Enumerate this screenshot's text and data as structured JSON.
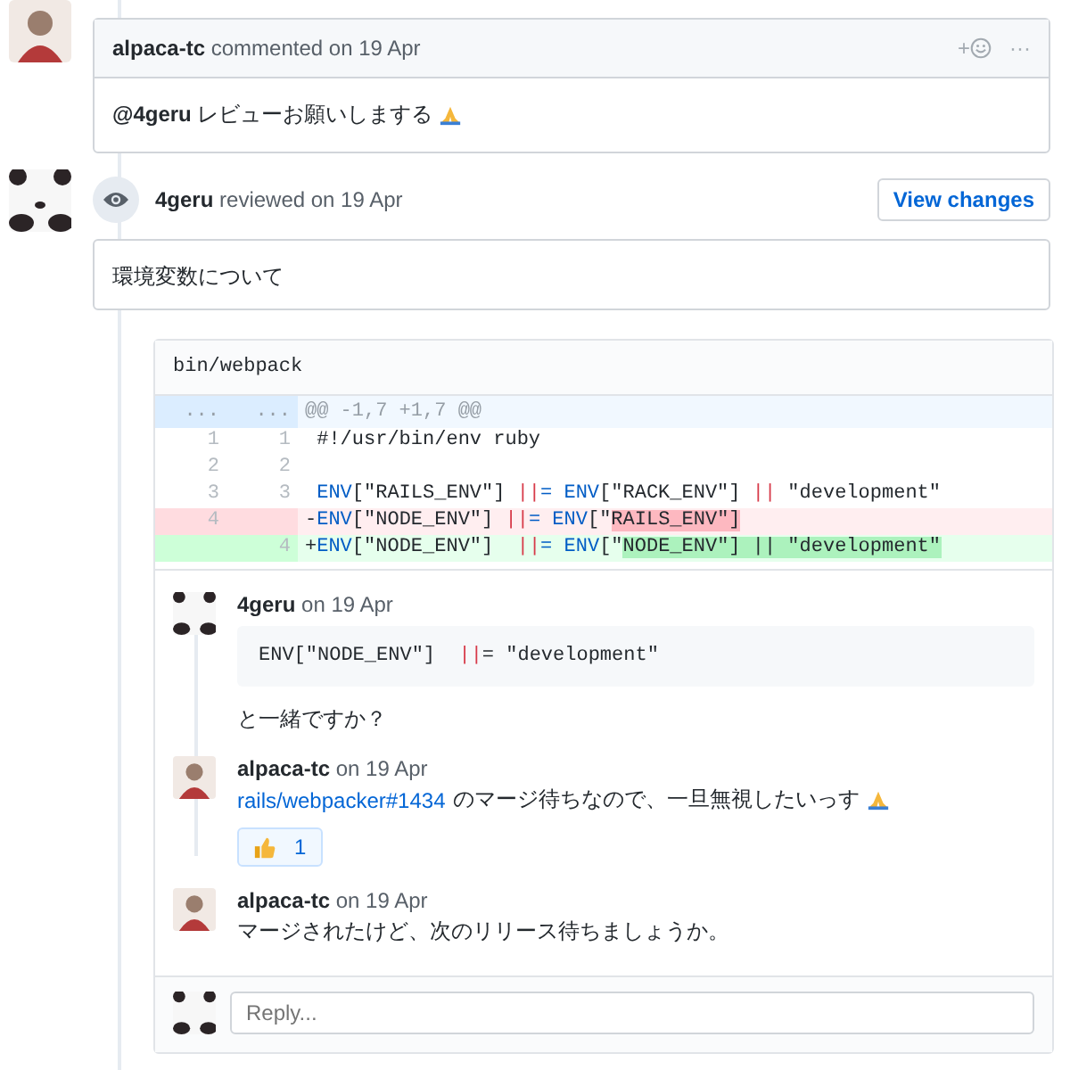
{
  "comment": {
    "author": "alpaca-tc",
    "action": "commented on 19 Apr",
    "add_reaction": "+",
    "more": "···",
    "mention": "@4geru",
    "body": "レビューお願いしまする"
  },
  "review": {
    "author": "4geru",
    "action": "reviewed on 19 Apr",
    "button": "View changes",
    "body": "環境変数について"
  },
  "diff": {
    "file": "bin/webpack",
    "lines": [
      {
        "kind": "hunk",
        "old": "...",
        "new": "...",
        "segments": [
          {
            "text": "@@ -1,7 +1,7 @@",
            "kind": "plain"
          }
        ]
      },
      {
        "kind": "context",
        "old": "1",
        "new": "1",
        "segments": [
          {
            "text": " #!/usr/bin/env ruby",
            "kind": "plain"
          }
        ]
      },
      {
        "kind": "context",
        "old": "2",
        "new": "2"
      },
      {
        "kind": "context",
        "old": "3",
        "new": "3",
        "segments": [
          {
            "text": " ENV",
            "kind": "const"
          },
          {
            "text": "[\"RAILS_ENV\"] ",
            "kind": "plain"
          },
          {
            "text": "||",
            "kind": "op"
          },
          {
            "text": "= ENV",
            "kind": "const"
          },
          {
            "text": "[\"RACK_ENV\"] ",
            "kind": "plain"
          },
          {
            "text": "||",
            "kind": "op"
          },
          {
            "text": " \"development\"",
            "kind": "plain"
          }
        ]
      },
      {
        "kind": "del",
        "old": "4",
        "segments": [
          {
            "text": "-",
            "kind": "plain"
          },
          {
            "text": "ENV",
            "kind": "const"
          },
          {
            "text": "[\"NODE_ENV\"] ",
            "kind": "plain"
          },
          {
            "text": "||",
            "kind": "op"
          },
          {
            "text": "= ENV",
            "kind": "const"
          },
          {
            "text": "[\"",
            "kind": "plain"
          },
          {
            "text": "RAILS_ENV\"]",
            "kind": "mark"
          }
        ]
      },
      {
        "kind": "add",
        "new": "4",
        "segments": [
          {
            "text": "+",
            "kind": "plain"
          },
          {
            "text": "ENV",
            "kind": "const"
          },
          {
            "text": "[\"NODE_ENV\"]  ",
            "kind": "plain"
          },
          {
            "text": "||",
            "kind": "op"
          },
          {
            "text": "= ENV",
            "kind": "const"
          },
          {
            "text": "[\"",
            "kind": "plain"
          },
          {
            "text": "NODE_ENV\"] || \"development\"",
            "kind": "mark"
          }
        ]
      }
    ]
  },
  "thread": [
    {
      "author": "4geru",
      "avatar": {
        "kind": "panda"
      },
      "meta": "on 19 Apr",
      "code": [
        {
          "text": "ENV[\"NODE_ENV\"]  ",
          "kind": "plain"
        },
        {
          "text": "||",
          "kind": "op"
        },
        {
          "text": "= \"development\"",
          "kind": "plain"
        }
      ],
      "body": "と一緒ですか？"
    },
    {
      "author": "alpaca-tc",
      "avatar": {
        "kind": "figure"
      },
      "meta": "on 19 Apr",
      "link": "rails/webpacker#1434",
      "body": "のマージ待ちなので、一旦無視したいっす",
      "reaction": {
        "count": "1",
        "selected": true
      }
    },
    {
      "author": "alpaca-tc",
      "avatar": {
        "kind": "figure"
      },
      "meta": "on 19 Apr",
      "body": "マージされたけど、次のリリース待ちましょうか。"
    }
  ],
  "reply": {
    "placeholder": "Reply..."
  }
}
